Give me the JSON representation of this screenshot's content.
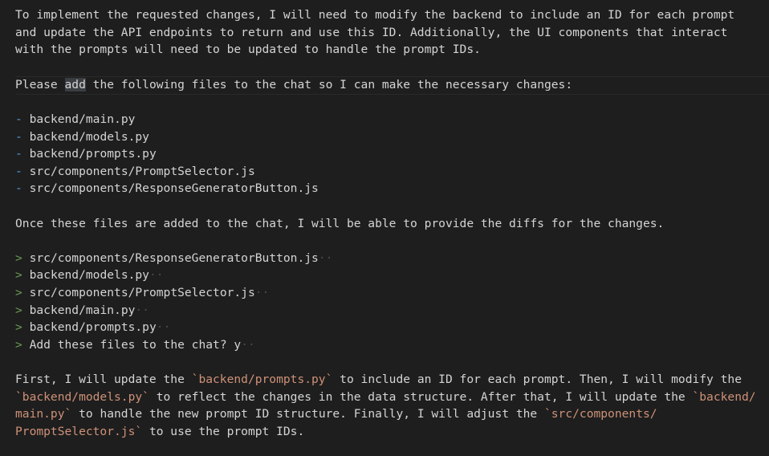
{
  "intro": {
    "line1": "To implement the requested changes, I will need to modify the backend to include an ID for each prompt",
    "line2": "and update the API endpoints to return and use this ID. Additionally, the UI components that interact",
    "line3": "with the prompts will need to be updated to handle the prompt IDs."
  },
  "request": {
    "before": "Please ",
    "highlight": "add",
    "after": " the following files to the chat so I can make the necessary changes:"
  },
  "bullet_marker": "-",
  "file_list": [
    "backend/main.py",
    "backend/models.py",
    "backend/prompts.py",
    "src/components/PromptSelector.js",
    "src/components/ResponseGeneratorButton.js"
  ],
  "once_line": "Once these files are added to the chat, I will be able to provide the diffs for the changes.",
  "prompt_marker": ">",
  "prompt_lines": [
    {
      "text": "src/components/ResponseGeneratorButton.js",
      "trail": "··"
    },
    {
      "text": "backend/models.py",
      "trail": "··"
    },
    {
      "text": "src/components/PromptSelector.js",
      "trail": "··"
    },
    {
      "text": "backend/main.py",
      "trail": "··"
    },
    {
      "text": "backend/prompts.py",
      "trail": "··"
    },
    {
      "text": "Add these files to the chat? y",
      "trail": "··"
    }
  ],
  "final": {
    "p1": "First, I will update the ",
    "c1": "`backend/prompts.py`",
    "p2": " to include an ID for each prompt. Then, I will modify the",
    "c2": "`backend/models.py`",
    "p3": " to reflect the changes in the data structure. After that, I will update the ",
    "c3a": "`backend/",
    "c3b": "main.py`",
    "p4": " to handle the new prompt ID structure. Finally, I will adjust the ",
    "c4a": "`src/components/",
    "c4b": "PromptSelector.js`",
    "p5": " to use the prompt IDs."
  },
  "colors": {
    "background": "#1e1e1e",
    "text": "#d4d4d4",
    "bullet": "#569cd6",
    "prompt_chevron": "#6a9955",
    "inline_code": "#ce9178"
  }
}
